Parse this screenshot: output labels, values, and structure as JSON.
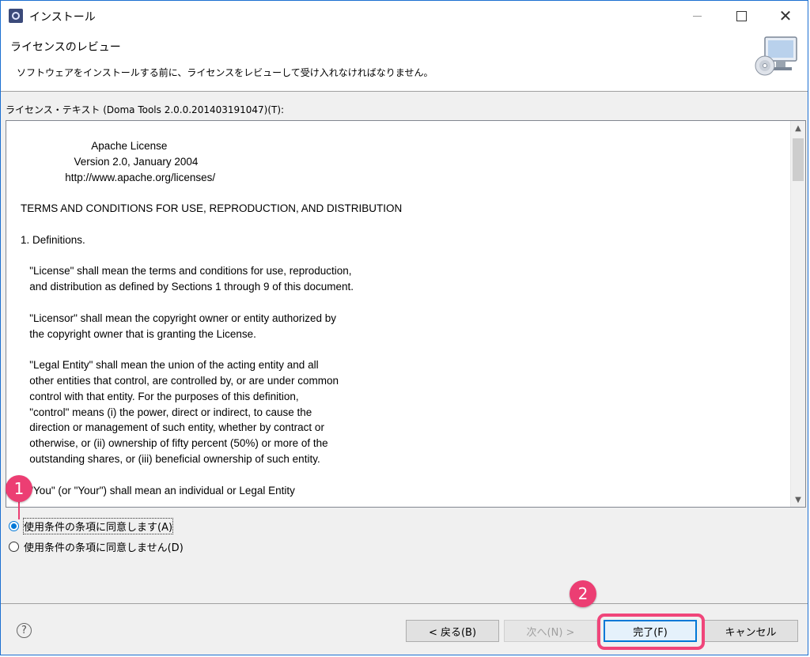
{
  "window": {
    "title": "インストール"
  },
  "header": {
    "title": "ライセンスのレビュー",
    "description": "ソフトウェアをインストールする前に、ライセンスをレビューして受け入れなければなりません。"
  },
  "license": {
    "label": "ライセンス・テキスト (Doma Tools 2.0.0.201403191047)(T):",
    "text": "                        Apache License\n                  Version 2.0, January 2004\n               http://www.apache.org/licenses/\n\nTERMS AND CONDITIONS FOR USE, REPRODUCTION, AND DISTRIBUTION\n\n1. Definitions.\n\n   \"License\" shall mean the terms and conditions for use, reproduction,\n   and distribution as defined by Sections 1 through 9 of this document.\n\n   \"Licensor\" shall mean the copyright owner or entity authorized by\n   the copyright owner that is granting the License.\n\n   \"Legal Entity\" shall mean the union of the acting entity and all\n   other entities that control, are controlled by, or are under common\n   control with that entity. For the purposes of this definition,\n   \"control\" means (i) the power, direct or indirect, to cause the\n   direction or management of such entity, whether by contract or\n   otherwise, or (ii) ownership of fifty percent (50%) or more of the\n   outstanding shares, or (iii) beneficial ownership of such entity.\n\n   \"You\" (or \"Your\") shall mean an individual or Legal Entity"
  },
  "options": {
    "accept": "使用条件の条項に同意します(A)",
    "decline": "使用条件の条項に同意しません(D)",
    "selected": "accept"
  },
  "buttons": {
    "back": "< 戻る(B)",
    "next": "次へ(N) >",
    "finish": "完了(F)",
    "cancel": "キャンセル",
    "help": "?"
  },
  "annotations": {
    "marker1": "1",
    "marker2": "2"
  },
  "colors": {
    "accent": "#0078d7",
    "annotation": "#ec3e73"
  }
}
